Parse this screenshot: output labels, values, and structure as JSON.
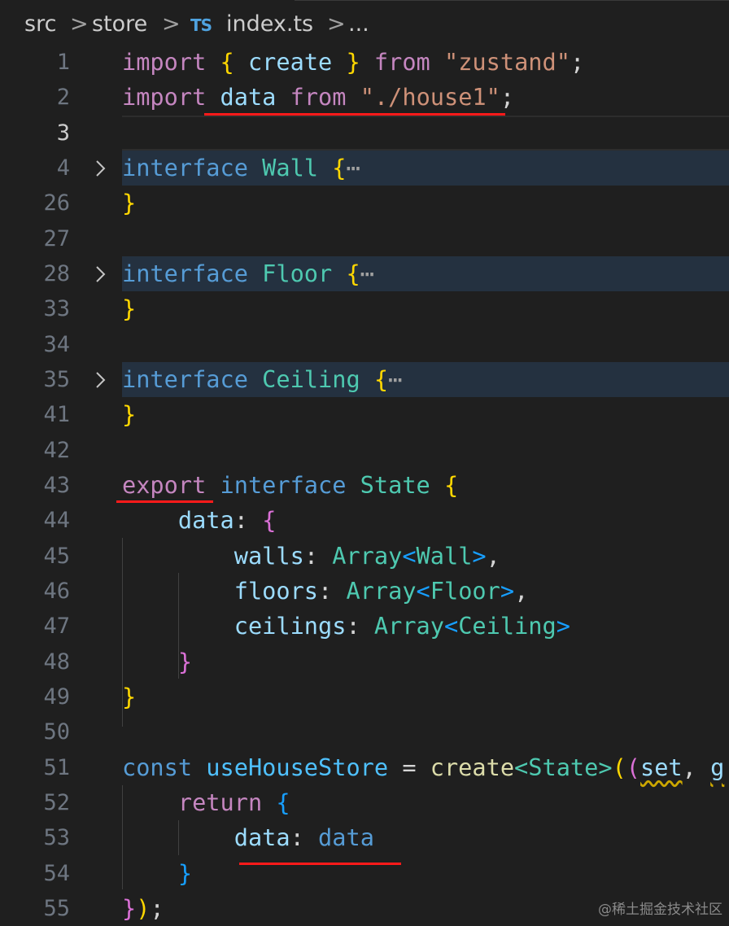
{
  "breadcrumb": {
    "seg1": "src",
    "sep": ">",
    "seg2": "store",
    "ts_badge": "TS",
    "seg3": "index.ts",
    "more": "..."
  },
  "lines": {
    "l1": {
      "num": "1",
      "t1": "import",
      "t2": "{",
      "t3": "create",
      "t4": "}",
      "t5": "from",
      "t6": "\"zustand\"",
      "t7": ";"
    },
    "l2": {
      "num": "2",
      "t1": "import",
      "t2": "data",
      "t3": "from",
      "t4": "\"./house1\"",
      "t5": ";"
    },
    "l3": {
      "num": "3"
    },
    "l4": {
      "num": "4",
      "t1": "interface",
      "t2": "Wall",
      "t3": "{",
      "t4": "⋯"
    },
    "l26": {
      "num": "26",
      "t1": "}"
    },
    "l27": {
      "num": "27"
    },
    "l28": {
      "num": "28",
      "t1": "interface",
      "t2": "Floor",
      "t3": "{",
      "t4": "⋯"
    },
    "l33": {
      "num": "33",
      "t1": "}"
    },
    "l34": {
      "num": "34"
    },
    "l35": {
      "num": "35",
      "t1": "interface",
      "t2": "Ceiling",
      "t3": "{",
      "t4": "⋯"
    },
    "l41": {
      "num": "41",
      "t1": "}"
    },
    "l42": {
      "num": "42"
    },
    "l43": {
      "num": "43",
      "t1": "export",
      "t2": "interface",
      "t3": "State",
      "t4": "{"
    },
    "l44": {
      "num": "44",
      "t1": "data",
      "t2": ":",
      "t3": "{"
    },
    "l45": {
      "num": "45",
      "t1": "walls",
      "t2": ":",
      "t3": "Array",
      "t4": "<",
      "t5": "Wall",
      "t6": ">",
      "t7": ","
    },
    "l46": {
      "num": "46",
      "t1": "floors",
      "t2": ":",
      "t3": "Array",
      "t4": "<",
      "t5": "Floor",
      "t6": ">",
      "t7": ","
    },
    "l47": {
      "num": "47",
      "t1": "ceilings",
      "t2": ":",
      "t3": "Array",
      "t4": "<",
      "t5": "Ceiling",
      "t6": ">"
    },
    "l48": {
      "num": "48",
      "t1": "}"
    },
    "l49": {
      "num": "49",
      "t1": "}"
    },
    "l50": {
      "num": "50"
    },
    "l51": {
      "num": "51",
      "t1": "const",
      "t2": "useHouseStore",
      "t3": "=",
      "t4": "create",
      "t5": "<",
      "t6": "State",
      "t7": ">",
      "t8": "(",
      "t9": "(",
      "t10": "set",
      "t11": ",",
      "t12": "g"
    },
    "l52": {
      "num": "52",
      "t1": "return",
      "t2": "{"
    },
    "l53": {
      "num": "53",
      "t1": "data",
      "t2": ":",
      "t3": "data"
    },
    "l54": {
      "num": "54",
      "t1": "}"
    },
    "l55": {
      "num": "55",
      "t1": "}",
      "t2": ")",
      "t3": ";"
    }
  },
  "watermark": "@稀土掘金技术社区",
  "colors": {
    "background": "#1f1f1f",
    "annotation_red": "#ff1a1a",
    "fold_highlight": "#243140"
  }
}
